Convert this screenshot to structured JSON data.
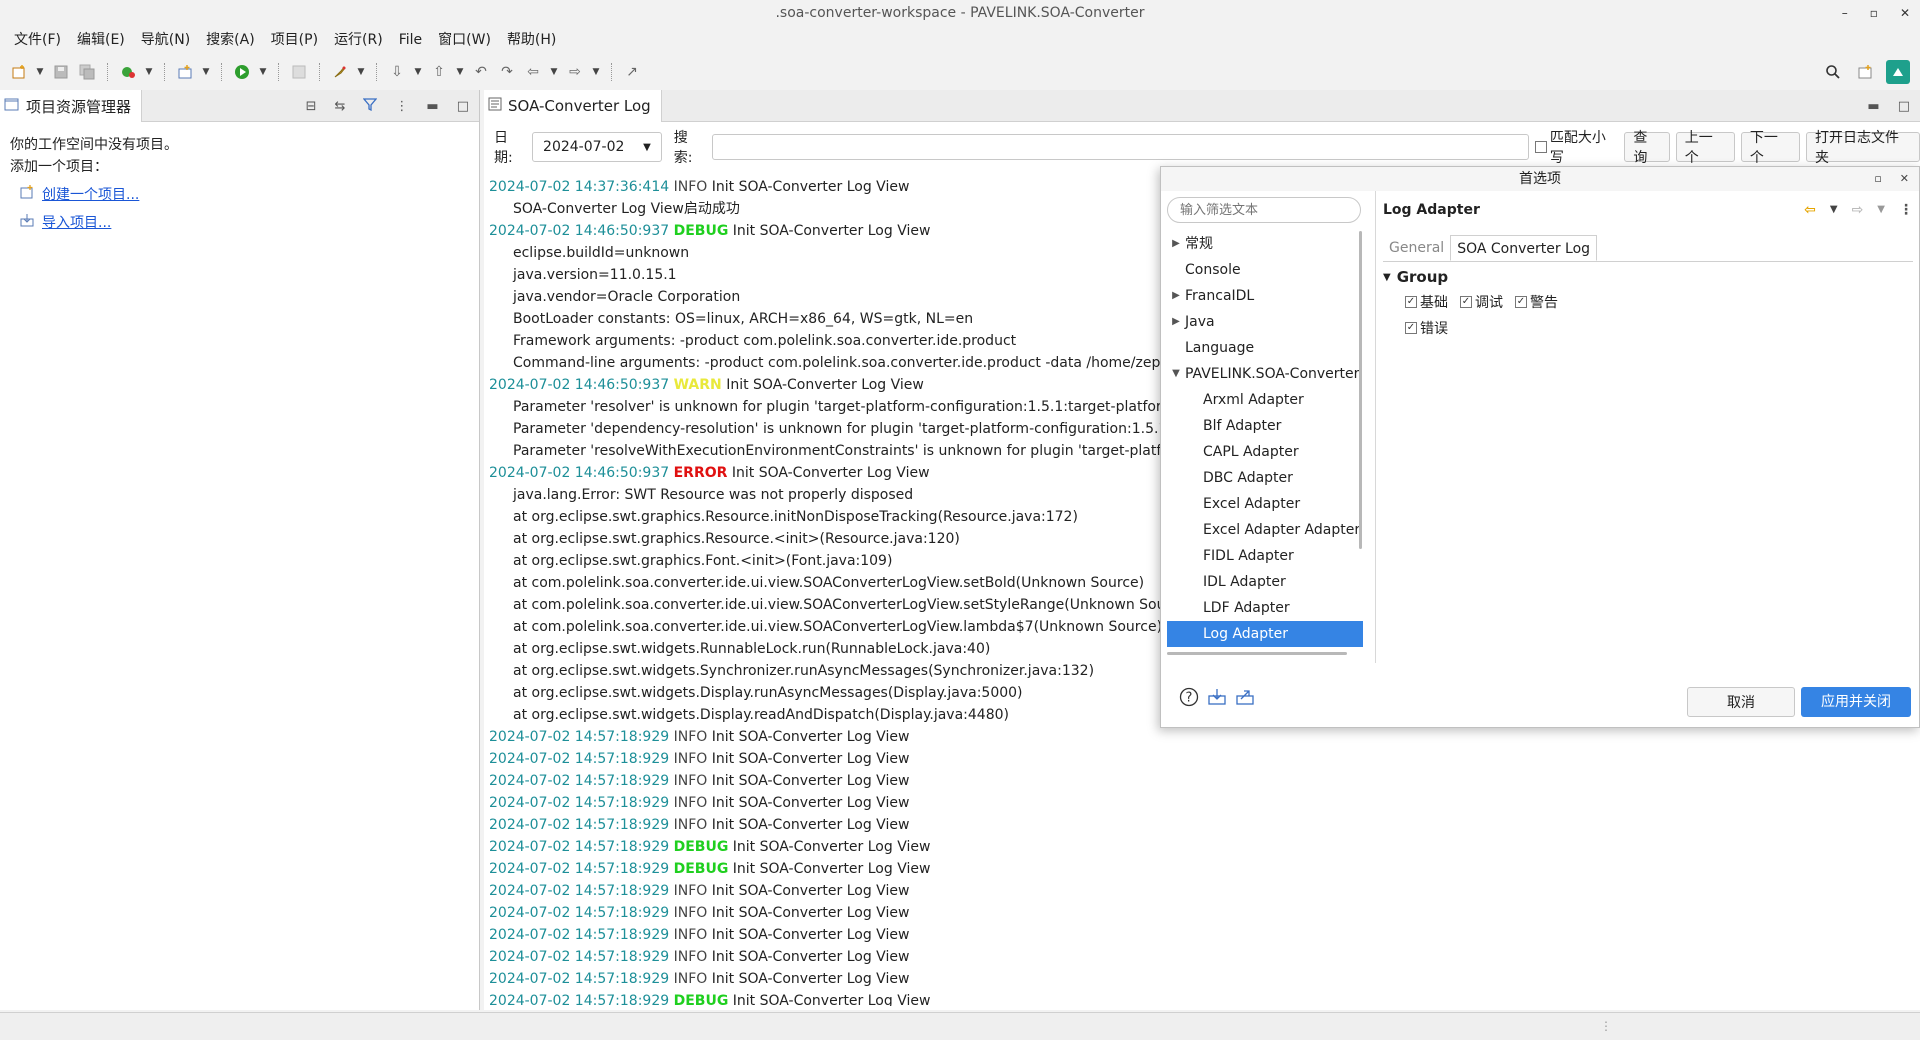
{
  "window": {
    "title": ".soa-converter-workspace - PAVELINK.SOA-Converter",
    "controls": [
      "–",
      "▫",
      "✕"
    ]
  },
  "menubar": [
    "文件(F)",
    "编辑(E)",
    "导航(N)",
    "搜索(A)",
    "项目(P)",
    "运行(R)",
    "File",
    "窗口(W)",
    "帮助(H)"
  ],
  "left_panel": {
    "tab_title": "项目资源管理器",
    "line1": "你的工作空间中没有项目。",
    "line2": "添加一个项目：",
    "link_create": "创建一个项目...",
    "link_import": "导入项目..."
  },
  "log_panel": {
    "tab_title": "SOA-Converter Log",
    "date_label": "日期:",
    "date_value": "2024-07-02",
    "search_label": "搜索:",
    "search_value": "",
    "match_case_label": "匹配大小写",
    "query_button": "查询",
    "prev_button": "上一个",
    "next_button": "下一个",
    "open_folder_button": "打开日志文件夹",
    "lines": [
      {
        "ts": "2024-07-02 14:37:36:414",
        "level": "INFO",
        "msg": "Init SOA-Converter Log View"
      },
      {
        "cont": "SOA-Converter Log View启动成功"
      },
      {
        "ts": "2024-07-02 14:46:50:937",
        "level": "DEBUG",
        "msg": "Init SOA-Converter Log View"
      },
      {
        "cont": "eclipse.buildId=unknown"
      },
      {
        "cont": "java.version=11.0.15.1"
      },
      {
        "cont": "java.vendor=Oracle Corporation"
      },
      {
        "cont": "BootLoader constants: OS=linux, ARCH=x86_64, WS=gtk, NL=en"
      },
      {
        "cont": "Framework arguments:  -product com.polelink.soa.converter.ide.product"
      },
      {
        "cont": "Command-line arguments:  -product com.polelink.soa.converter.ide.product -data /home/zephyr/."
      },
      {
        "ts": "2024-07-02 14:46:50:937",
        "level": "WARN",
        "msg": "Init SOA-Converter Log View"
      },
      {
        "cont": "Parameter 'resolver' is unknown for plugin 'target-platform-configuration:1.5.1:target-platform (de"
      },
      {
        "cont": "Parameter 'dependency-resolution' is unknown for plugin 'target-platform-configuration:1.5.1:targ"
      },
      {
        "cont": "Parameter 'resolveWithExecutionEnvironmentConstraints' is unknown for plugin 'target-platform-c"
      },
      {
        "ts": "2024-07-02 14:46:50:937",
        "level": "ERROR",
        "msg": "Init SOA-Converter Log View"
      },
      {
        "cont": "java.lang.Error: SWT Resource was not properly disposed"
      },
      {
        "cont": "at org.eclipse.swt.graphics.Resource.initNonDisposeTracking(Resource.java:172)"
      },
      {
        "cont": "at org.eclipse.swt.graphics.Resource.<init>(Resource.java:120)"
      },
      {
        "cont": "at org.eclipse.swt.graphics.Font.<init>(Font.java:109)"
      },
      {
        "cont": "at com.polelink.soa.converter.ide.ui.view.SOAConverterLogView.setBold(Unknown Source)"
      },
      {
        "cont": "at com.polelink.soa.converter.ide.ui.view.SOAConverterLogView.setStyleRange(Unknown Source)"
      },
      {
        "cont": "at com.polelink.soa.converter.ide.ui.view.SOAConverterLogView.lambda$7(Unknown Source)"
      },
      {
        "cont": "at org.eclipse.swt.widgets.RunnableLock.run(RunnableLock.java:40)"
      },
      {
        "cont": "at org.eclipse.swt.widgets.Synchronizer.runAsyncMessages(Synchronizer.java:132)"
      },
      {
        "cont": "at org.eclipse.swt.widgets.Display.runAsyncMessages(Display.java:5000)"
      },
      {
        "cont": "at org.eclipse.swt.widgets.Display.readAndDispatch(Display.java:4480)"
      },
      {
        "ts": "2024-07-02 14:57:18:929",
        "level": "INFO",
        "msg": "Init SOA-Converter Log View"
      },
      {
        "ts": "2024-07-02 14:57:18:929",
        "level": "INFO",
        "msg": "Init SOA-Converter Log View"
      },
      {
        "ts": "2024-07-02 14:57:18:929",
        "level": "INFO",
        "msg": "Init SOA-Converter Log View"
      },
      {
        "ts": "2024-07-02 14:57:18:929",
        "level": "INFO",
        "msg": "Init SOA-Converter Log View"
      },
      {
        "ts": "2024-07-02 14:57:18:929",
        "level": "INFO",
        "msg": "Init SOA-Converter Log View"
      },
      {
        "ts": "2024-07-02 14:57:18:929",
        "level": "DEBUG",
        "msg": "Init SOA-Converter Log View"
      },
      {
        "ts": "2024-07-02 14:57:18:929",
        "level": "DEBUG",
        "msg": "Init SOA-Converter Log View"
      },
      {
        "ts": "2024-07-02 14:57:18:929",
        "level": "INFO",
        "msg": "Init SOA-Converter Log View"
      },
      {
        "ts": "2024-07-02 14:57:18:929",
        "level": "INFO",
        "msg": "Init SOA-Converter Log View"
      },
      {
        "ts": "2024-07-02 14:57:18:929",
        "level": "INFO",
        "msg": "Init SOA-Converter Log View"
      },
      {
        "ts": "2024-07-02 14:57:18:929",
        "level": "INFO",
        "msg": "Init SOA-Converter Log View"
      },
      {
        "ts": "2024-07-02 14:57:18:929",
        "level": "INFO",
        "msg": "Init SOA-Converter Log View"
      },
      {
        "ts": "2024-07-02 14:57:18:929",
        "level": "DEBUG",
        "msg": "Init SOA-Converter Log View"
      }
    ]
  },
  "preferences": {
    "title": "首选项",
    "filter_placeholder": "输入筛选文本",
    "tree": [
      {
        "label": "常规",
        "kind": "expandable"
      },
      {
        "label": "Console",
        "kind": "leaf"
      },
      {
        "label": "FrancaIDL",
        "kind": "expandable"
      },
      {
        "label": "Java",
        "kind": "expandable"
      },
      {
        "label": "Language",
        "kind": "leaf"
      },
      {
        "label": "PAVELINK.SOA-Converter",
        "kind": "expanded"
      },
      {
        "label": "Arxml Adapter",
        "kind": "child"
      },
      {
        "label": "Blf Adapter",
        "kind": "child"
      },
      {
        "label": "CAPL Adapter",
        "kind": "child"
      },
      {
        "label": "DBC Adapter",
        "kind": "child"
      },
      {
        "label": "Excel Adapter",
        "kind": "child"
      },
      {
        "label": "Excel Adapter Adapter",
        "kind": "child"
      },
      {
        "label": "FIDL Adapter",
        "kind": "child"
      },
      {
        "label": "IDL Adapter",
        "kind": "child"
      },
      {
        "label": "LDF Adapter",
        "kind": "child"
      },
      {
        "label": "Log Adapter",
        "kind": "child",
        "selected": true
      }
    ],
    "page_title": "Log Adapter",
    "tabs": [
      "General",
      "SOA Converter Log"
    ],
    "active_tab": "SOA Converter Log",
    "group_label": "Group",
    "checkboxes_row1": [
      {
        "label": "基础",
        "checked": true
      },
      {
        "label": "调试",
        "checked": true
      },
      {
        "label": "警告",
        "checked": true
      }
    ],
    "checkboxes_row2": [
      {
        "label": "错误",
        "checked": true
      }
    ],
    "cancel_button": "取消",
    "apply_button": "应用并关闭"
  },
  "colors": {
    "accent": "#3584e4",
    "timestamp": "#1d8f98",
    "debug": "#1fcf1f",
    "warn": "#e9e93b",
    "error": "#e01010",
    "link": "#1a56d6"
  }
}
